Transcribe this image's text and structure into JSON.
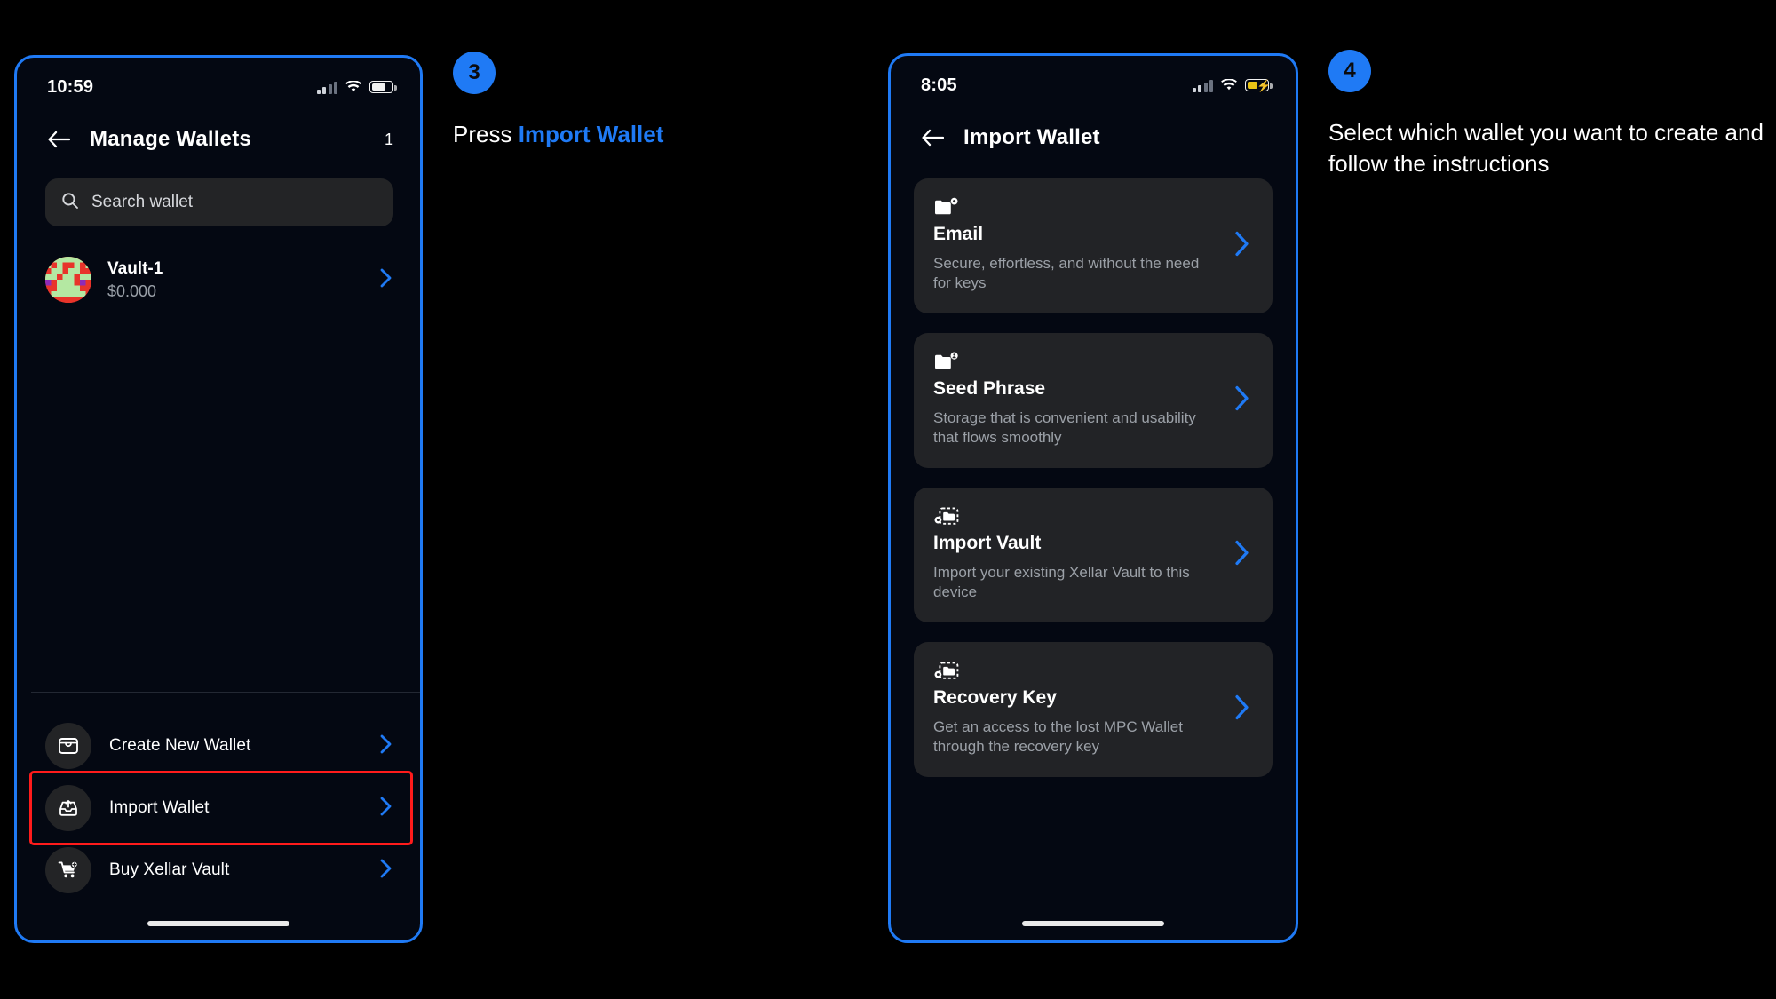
{
  "page": {
    "background": "#000000",
    "accent_blue": "#1f7af5",
    "highlight_red": "#ff1b1b",
    "card_bg": "#222326",
    "muted_text": "#9ba0a7"
  },
  "phone_1": {
    "status_bar": {
      "time": "10:59",
      "signal_icon": "cellular-bars-icon",
      "wifi_icon": "wifi-icon",
      "battery_icon": "battery-icon",
      "battery_charging": false
    },
    "nav": {
      "back_icon": "back-arrow-icon",
      "title": "Manage Wallets",
      "count": "1"
    },
    "search": {
      "icon": "search-icon",
      "placeholder": "Search wallet",
      "value": ""
    },
    "wallets": [
      {
        "avatar_icon": "identicon-avatar",
        "name": "Vault-1",
        "balance": "$0.000",
        "chevron_icon": "chevron-right-icon"
      }
    ],
    "menu": [
      {
        "icon": "create-wallet-icon",
        "label": "Create New Wallet",
        "chevron_icon": "chevron-right-icon",
        "highlighted": false
      },
      {
        "icon": "import-wallet-icon",
        "label": "Import Wallet",
        "chevron_icon": "chevron-right-icon",
        "highlighted": true
      },
      {
        "icon": "buy-cart-icon",
        "label": "Buy Xellar Vault",
        "chevron_icon": "chevron-right-icon",
        "highlighted": false
      }
    ],
    "home_indicator": "home-indicator"
  },
  "phone_2": {
    "status_bar": {
      "time": "8:05",
      "signal_icon": "cellular-bars-icon",
      "wifi_icon": "wifi-icon",
      "battery_icon": "battery-charging-icon",
      "battery_charging": true
    },
    "nav": {
      "back_icon": "back-arrow-icon",
      "title": "Import Wallet"
    },
    "options": [
      {
        "icon": "folder-gear-icon",
        "title": "Email",
        "description": "Secure, effortless, and without the need for keys",
        "chevron_icon": "chevron-right-icon"
      },
      {
        "icon": "folder-lock-icon",
        "title": "Seed Phrase",
        "description": "Storage that is convenient and usability that flows smoothly",
        "chevron_icon": "chevron-right-icon"
      },
      {
        "icon": "folder-dashed-icon",
        "title": "Import Vault",
        "description": "Import your existing Xellar Vault to this device",
        "chevron_icon": "chevron-right-icon"
      },
      {
        "icon": "folder-dashed-icon",
        "title": "Recovery Key",
        "description": "Get an access to the lost MPC Wallet through the recovery key",
        "chevron_icon": "chevron-right-icon"
      }
    ],
    "home_indicator": "home-indicator"
  },
  "callouts": [
    {
      "number": "3",
      "text_prefix": "Press ",
      "text_accent": "Import Wallet",
      "text_suffix": ""
    },
    {
      "number": "4",
      "text_prefix": "Select which wallet you want to create and follow the instructions",
      "text_accent": "",
      "text_suffix": ""
    }
  ]
}
